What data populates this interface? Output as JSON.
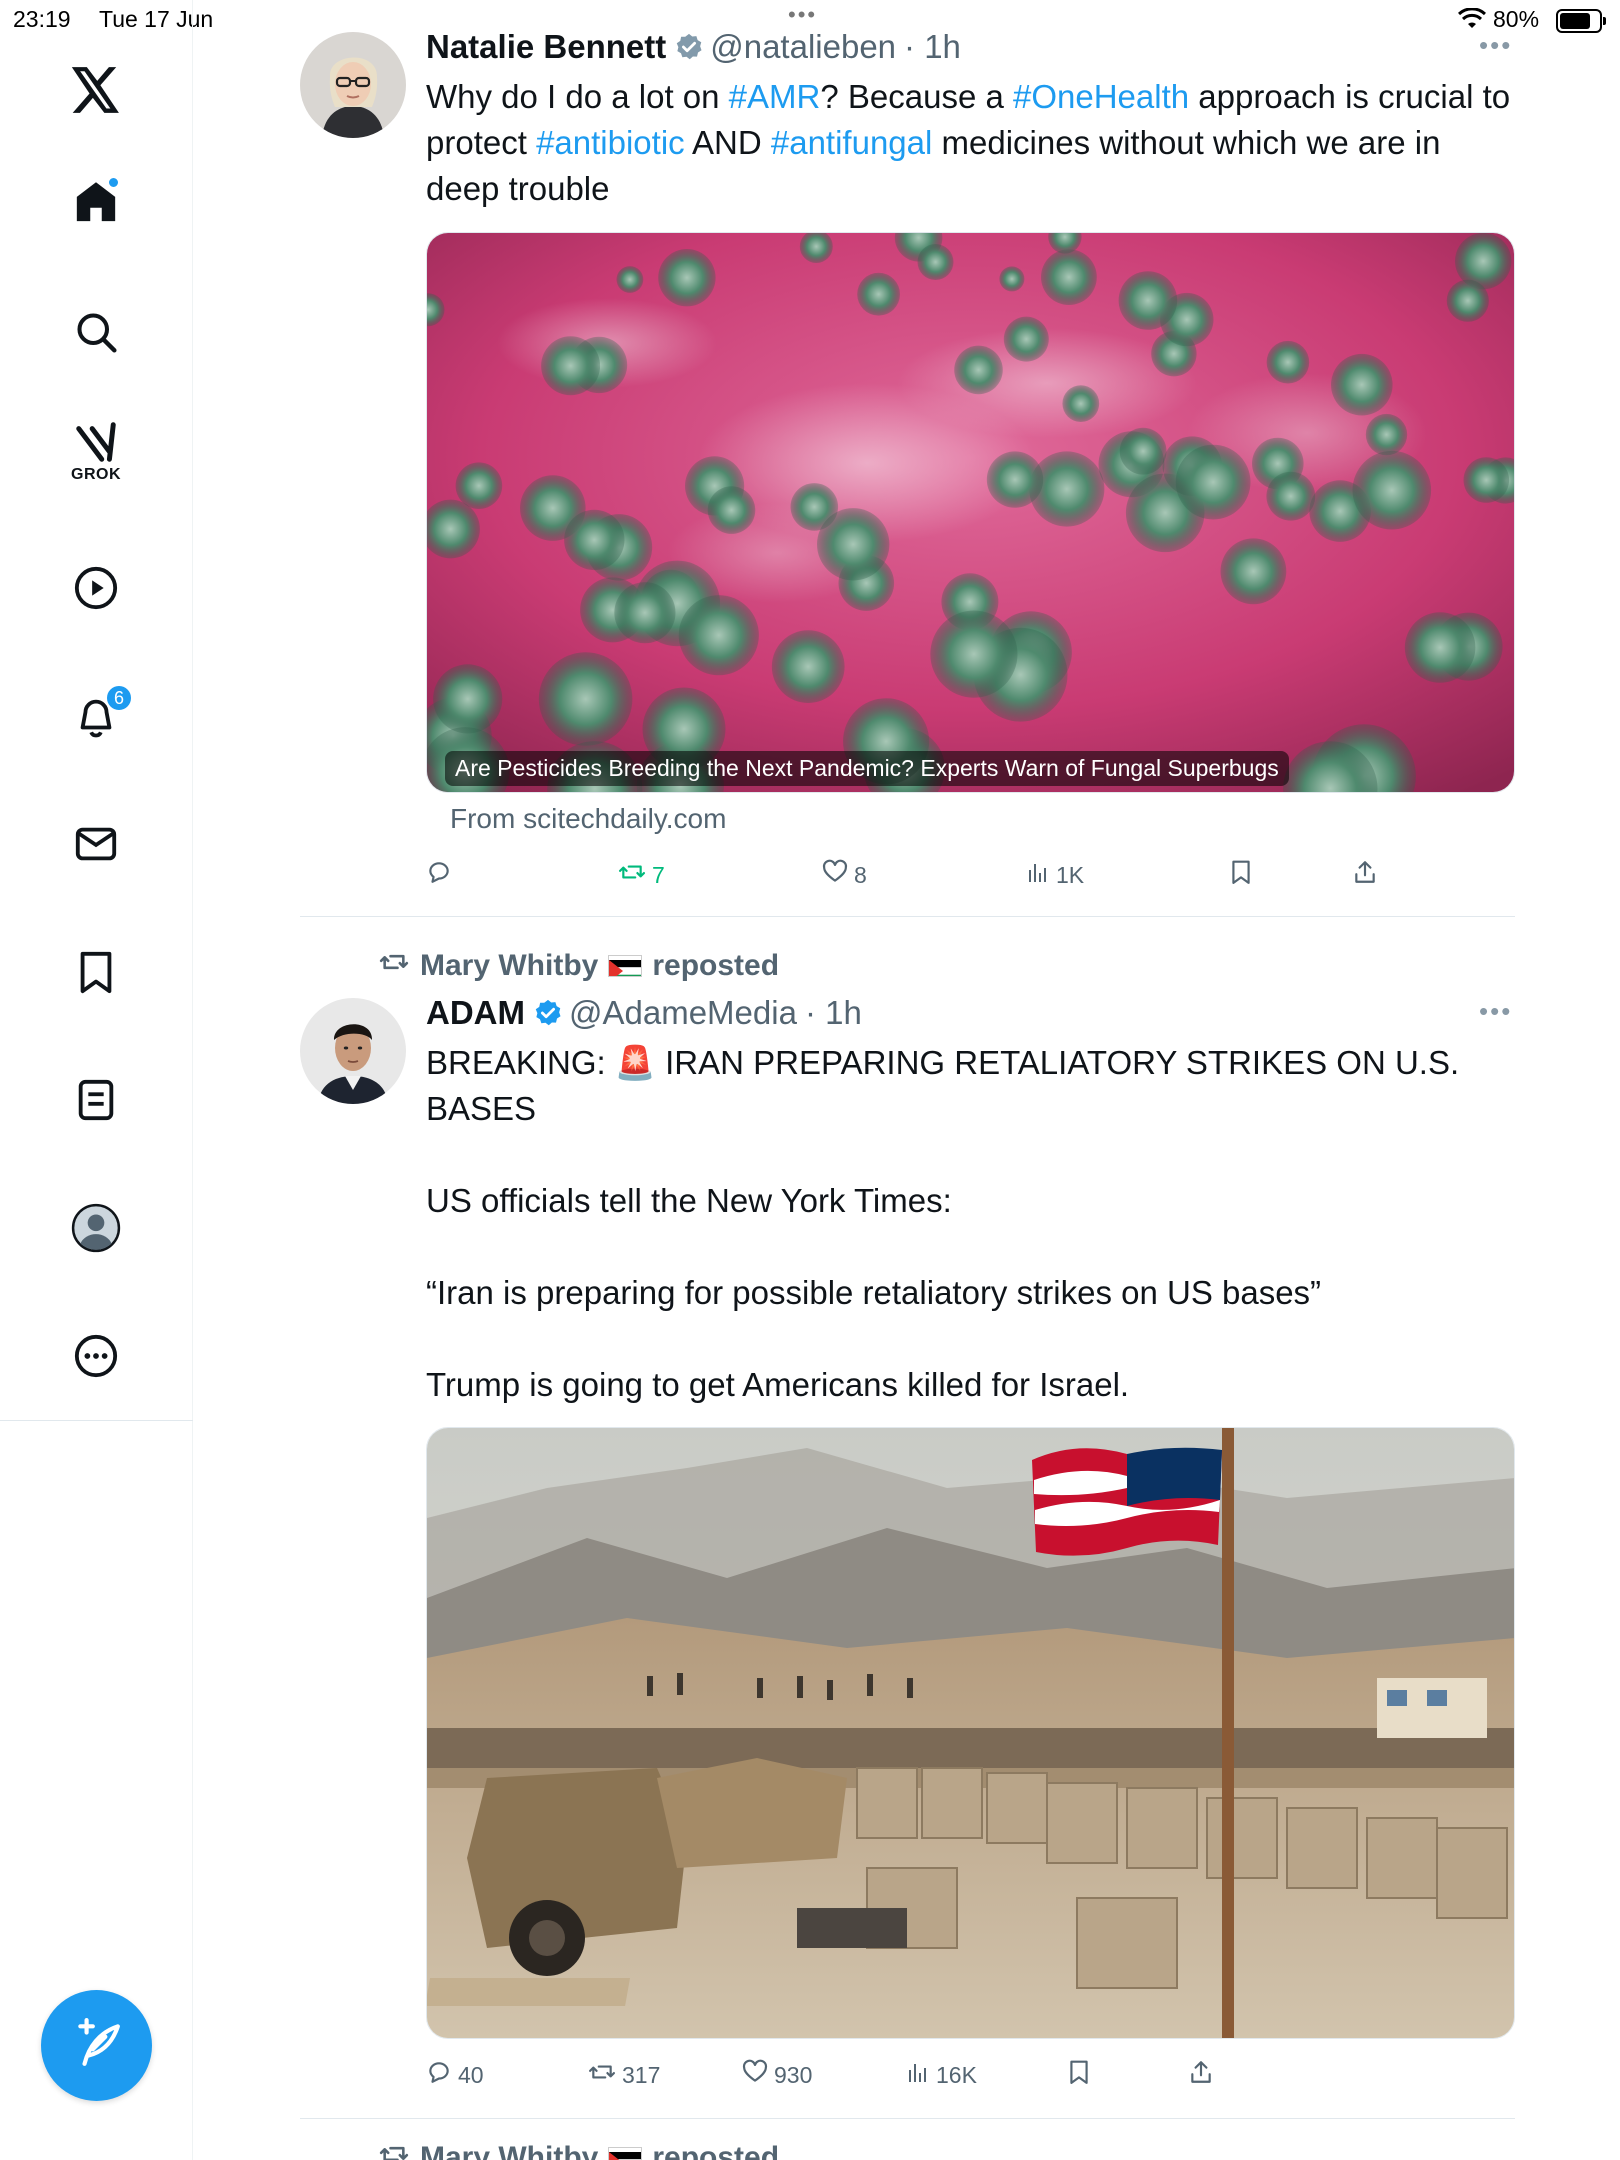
{
  "status_bar": {
    "time": "23:19",
    "date": "Tue 17 Jun",
    "battery": "80%",
    "battery_level": 0.8
  },
  "sidebar": {
    "logo": "x-logo-icon",
    "items": [
      {
        "icon": "home-icon",
        "active": true,
        "has_dot": true
      },
      {
        "icon": "search-icon"
      },
      {
        "icon": "grok-icon",
        "label": "GROK"
      },
      {
        "icon": "video-icon"
      },
      {
        "icon": "notifications-icon",
        "badge": "6"
      },
      {
        "icon": "messages-icon"
      },
      {
        "icon": "bookmarks-icon"
      },
      {
        "icon": "lists-icon"
      },
      {
        "icon": "profile-icon"
      },
      {
        "icon": "more-icon"
      }
    ],
    "compose_icon": "compose-icon"
  },
  "colors": {
    "accent": "#1d9bf0",
    "text": "#0f1419",
    "secondary": "#536471",
    "repost_green": "#00ba7c"
  },
  "tweets": [
    {
      "name": "Natalie Bennett",
      "handle": "@natalieben",
      "time": "· 1h",
      "verified": "grey",
      "text_segments": [
        {
          "t": "Why do I do a lot on ",
          "tag": false
        },
        {
          "t": "#AMR",
          "tag": true
        },
        {
          "t": "? Because a ",
          "tag": false
        },
        {
          "t": "#OneHealth",
          "tag": true
        },
        {
          "t": " approach is crucial to protect ",
          "tag": false
        },
        {
          "t": "#antibiotic",
          "tag": true
        },
        {
          "t": " AND ",
          "tag": false
        },
        {
          "t": "#antifungal",
          "tag": true
        },
        {
          "t": " medicines without which we are in deep trouble",
          "tag": false
        }
      ],
      "card_caption": "Are Pesticides Breeding the Next Pandemic? Experts Warn of Fungal Superbugs",
      "card_source": "From scitechdaily.com",
      "actions": {
        "replies": "",
        "reposts": "7",
        "likes": "8",
        "views": "1K"
      }
    },
    {
      "reposted_by": "Mary Whitby",
      "reposted_label": "reposted",
      "name": "ADAM",
      "handle": "@AdameMedia",
      "time": "· 1h",
      "verified": "blue",
      "paragraphs": [
        "BREAKING: 🚨 IRAN PREPARING RETALIATORY STRIKES ON U.S. BASES",
        "",
        "US officials tell the New York Times:",
        "",
        "“Iran is preparing for possible retaliatory strikes on US bases”",
        "",
        "Trump is going to get Americans killed for Israel."
      ],
      "actions": {
        "replies": "40",
        "reposts": "317",
        "likes": "930",
        "views": "16K"
      }
    }
  ],
  "next_repost": {
    "reposted_by": "Mary Whitby",
    "reposted_label": "reposted"
  }
}
